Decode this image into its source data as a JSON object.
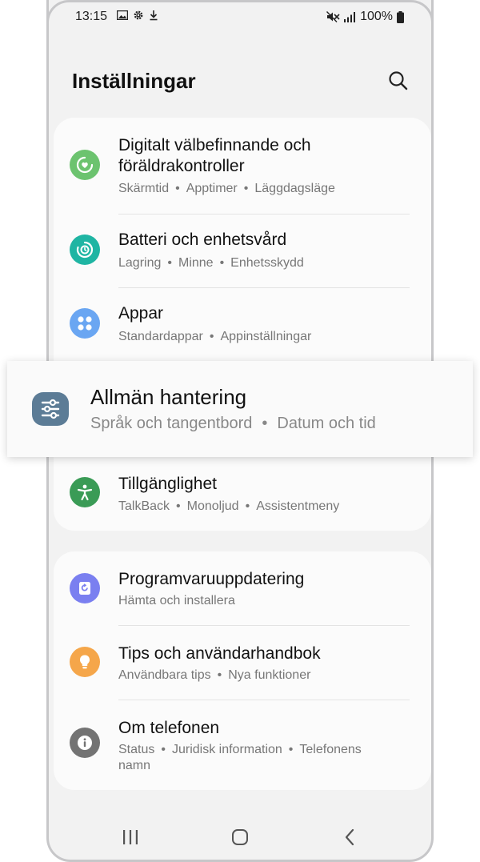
{
  "status_bar": {
    "time": "13:15",
    "battery": "100%",
    "left_icons": [
      "gallery-icon",
      "gear-icon",
      "download-icon"
    ],
    "right_icons": [
      "mute-icon",
      "signal-icon",
      "battery-icon"
    ]
  },
  "header": {
    "title": "Inställningar",
    "search_icon": "search-icon"
  },
  "card1": {
    "items": [
      {
        "title_line1": "Digitalt välbefinnande och",
        "title_line2": "föräldrakontroller",
        "subtitle": [
          "Skärmtid",
          "Apptimer",
          "Läggdagsläge"
        ],
        "icon": "wellbeing-icon",
        "color": "#6cc36f"
      },
      {
        "title": "Batteri och enhetsvård",
        "subtitle": [
          "Lagring",
          "Minne",
          "Enhetsskydd"
        ],
        "icon": "device-care-icon",
        "color": "#1fb5a3"
      },
      {
        "title": "Appar",
        "subtitle": [
          "Standardappar",
          "Appinställningar"
        ],
        "icon": "apps-icon",
        "color": "#6aa6f2"
      },
      {
        "title": "Tillgänglighet",
        "subtitle": [
          "TalkBack",
          "Monoljud",
          "Assistentmeny"
        ],
        "icon": "accessibility-icon",
        "color": "#3a9b56"
      }
    ]
  },
  "highlight": {
    "title": "Allmän hantering",
    "subtitle": [
      "Språk och tangentbord",
      "Datum och tid"
    ],
    "icon": "sliders-icon",
    "color": "#5c7c96"
  },
  "card2": {
    "items": [
      {
        "title": "Programvaruuppdatering",
        "subtitle": [
          "Hämta och installera"
        ],
        "icon": "update-icon",
        "color": "#7a7ff0"
      },
      {
        "title": "Tips och användarhandbok",
        "subtitle": [
          "Användbara tips",
          "Nya funktioner"
        ],
        "icon": "lightbulb-icon",
        "color": "#f5a64a"
      },
      {
        "title": "Om telefonen",
        "subtitle_line1": [
          "Status",
          "Juridisk information",
          "Telefonens"
        ],
        "subtitle_line2": "namn",
        "icon": "info-icon",
        "color": "#737373"
      }
    ]
  },
  "navbar": {
    "icons": [
      "recents-icon",
      "home-icon",
      "back-icon"
    ]
  }
}
